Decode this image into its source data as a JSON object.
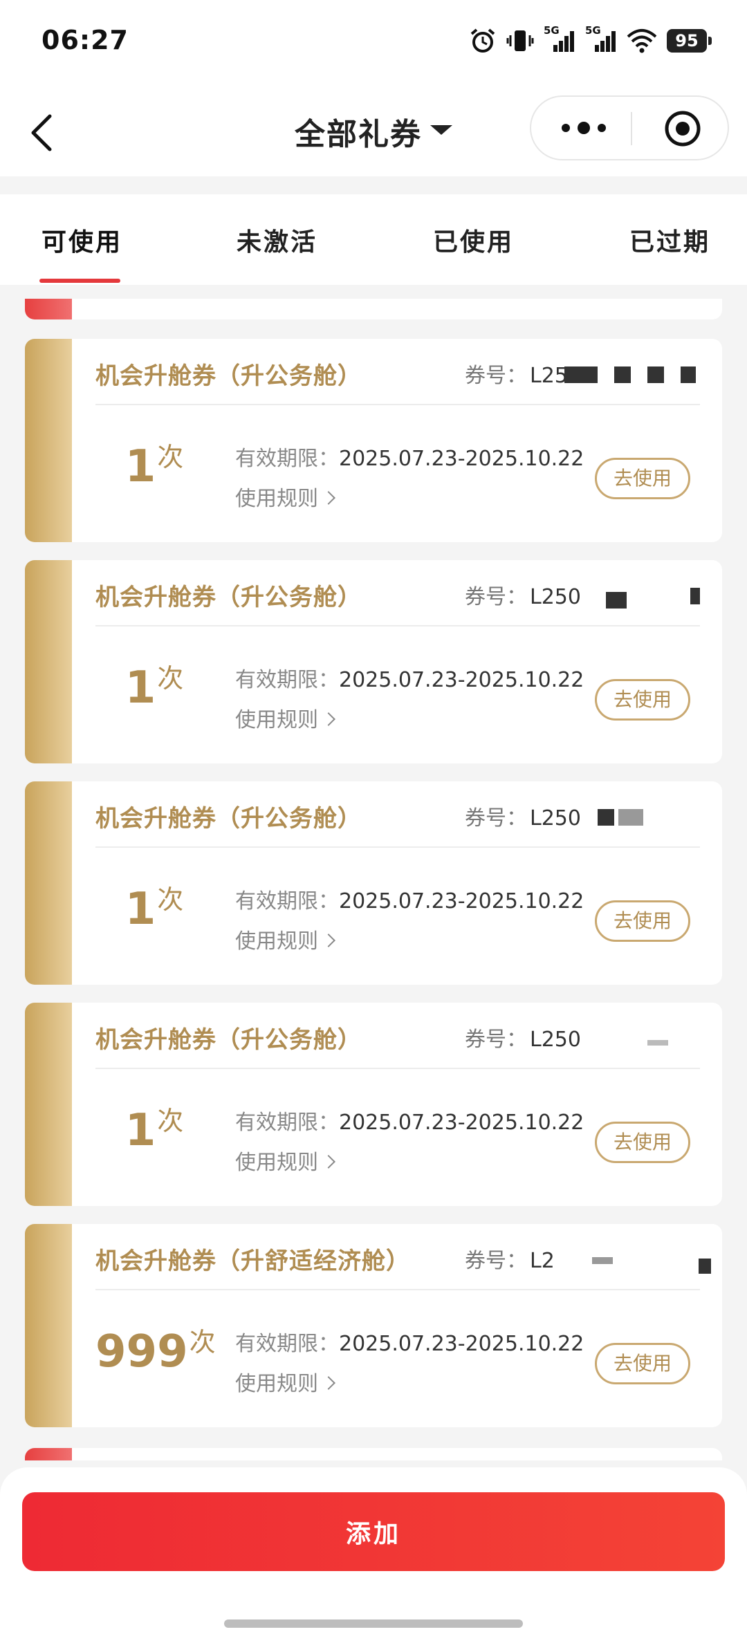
{
  "status_bar": {
    "time": "06:27",
    "battery": "95",
    "network1": "5G",
    "network2": "5G"
  },
  "nav": {
    "title": "全部礼券"
  },
  "tabs": [
    {
      "label": "可使用",
      "active": true
    },
    {
      "label": "未激活",
      "active": false
    },
    {
      "label": "已使用",
      "active": false
    },
    {
      "label": "已过期",
      "active": false
    }
  ],
  "coupons": [
    {
      "name": "机会升舱券（升公务舱）",
      "no_label": "券号：",
      "no_value": "L25",
      "count": "1",
      "unit": "次",
      "validity_label": "有效期限：",
      "validity": "2025.07.23-2025.10.22",
      "rules_label": "使用规则",
      "use_label": "去使用"
    },
    {
      "name": "机会升舱券（升公务舱）",
      "no_label": "券号：",
      "no_value": "L250",
      "count": "1",
      "unit": "次",
      "validity_label": "有效期限：",
      "validity": "2025.07.23-2025.10.22",
      "rules_label": "使用规则",
      "use_label": "去使用"
    },
    {
      "name": "机会升舱券（升公务舱）",
      "no_label": "券号：",
      "no_value": "L250",
      "count": "1",
      "unit": "次",
      "validity_label": "有效期限：",
      "validity": "2025.07.23-2025.10.22",
      "rules_label": "使用规则",
      "use_label": "去使用"
    },
    {
      "name": "机会升舱券（升公务舱）",
      "no_label": "券号：",
      "no_value": "L250",
      "count": "1",
      "unit": "次",
      "validity_label": "有效期限：",
      "validity": "2025.07.23-2025.10.22",
      "rules_label": "使用规则",
      "use_label": "去使用"
    },
    {
      "name": "机会升舱券（升舒适经济舱）",
      "no_label": "券号：",
      "no_value": "L2",
      "count": "999",
      "unit": "次",
      "validity_label": "有效期限：",
      "validity": "2025.07.23-2025.10.22",
      "rules_label": "使用规则",
      "use_label": "去使用"
    }
  ],
  "add_button": {
    "label": "添加"
  },
  "colors": {
    "accent": "#e4393c",
    "gold": "#b08d52",
    "button_red": "#f0393e"
  }
}
